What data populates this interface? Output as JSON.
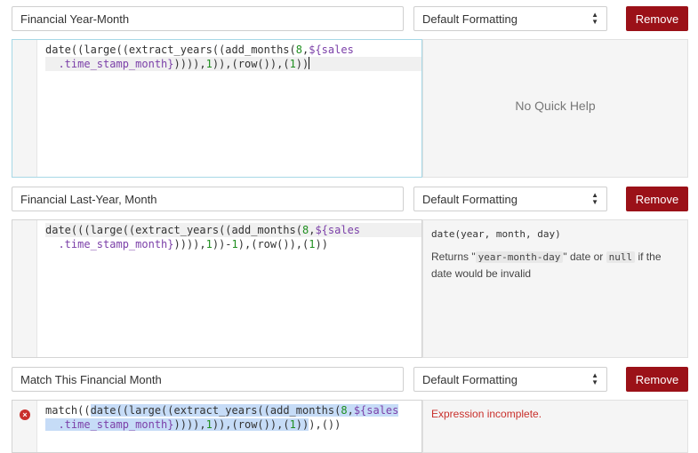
{
  "formulas": [
    {
      "name": "Financial Year-Month",
      "format": "Default Formatting",
      "remove_label": "Remove",
      "quick_help_empty": "No Quick Help"
    },
    {
      "name": "Financial Last-Year, Month",
      "format": "Default Formatting",
      "remove_label": "Remove",
      "help_signature": "date(year, month, day)",
      "help_returns_prefix": "Returns \"",
      "help_returns_code": "year-month-day",
      "help_returns_mid": "\" date or ",
      "help_returns_null": "null",
      "help_returns_suffix": " if the date would be invalid"
    },
    {
      "name": "Match This Financial Month",
      "format": "Default Formatting",
      "remove_label": "Remove",
      "error_message": "Expression incomplete."
    }
  ],
  "icons": {
    "select_arrow": "up-down-arrows",
    "error": "error-x-circle"
  },
  "colors": {
    "remove_button": "#9b1118",
    "number": "#1e8e1e",
    "template": "#7b3fa8",
    "error": "#c9302c"
  }
}
